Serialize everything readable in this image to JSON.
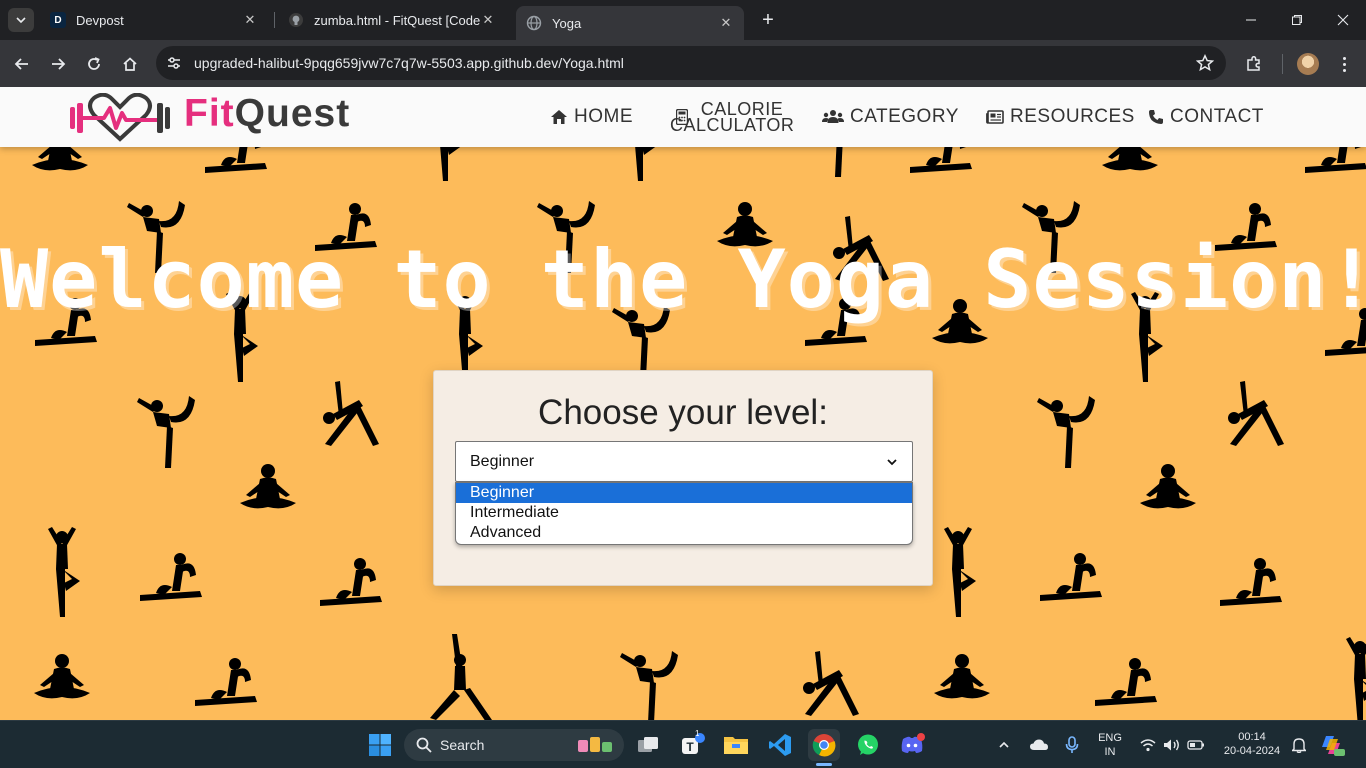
{
  "browser": {
    "tabs": [
      {
        "title": "Devpost",
        "favicon": "D"
      },
      {
        "title": "zumba.html - FitQuest [Codesp",
        "favicon": "github-icon"
      },
      {
        "title": "Yoga",
        "favicon": "globe-icon",
        "active": true
      }
    ],
    "close_glyph": "✕",
    "new_tab_glyph": "+",
    "url": "upgraded-halibut-9pqg659jvw7c7q7w-5503.app.github.dev/Yoga.html"
  },
  "site": {
    "logo": {
      "fit": "Fit",
      "quest": "Quest"
    },
    "nav": {
      "home": "HOME",
      "calorie_line1": "CALORIE",
      "calorie_line2": "CALCULATOR",
      "category": "CATEGORY",
      "resources": "RESOURCES",
      "contact": "CONTACT"
    },
    "hero_title": "Welcome to the Yoga Session!!",
    "level": {
      "heading": "Choose your level:",
      "selected": "Beginner",
      "options": [
        "Beginner",
        "Intermediate",
        "Advanced"
      ]
    },
    "colors": {
      "background": "#fdbb5a",
      "brand_pink": "#e52f7e",
      "select_highlight": "#1a6fd8"
    }
  },
  "taskbar": {
    "search_label": "Search",
    "lang_line1": "ENG",
    "lang_line2": "IN",
    "time": "00:14",
    "date": "20-04-2024",
    "teams_badge": "1"
  }
}
